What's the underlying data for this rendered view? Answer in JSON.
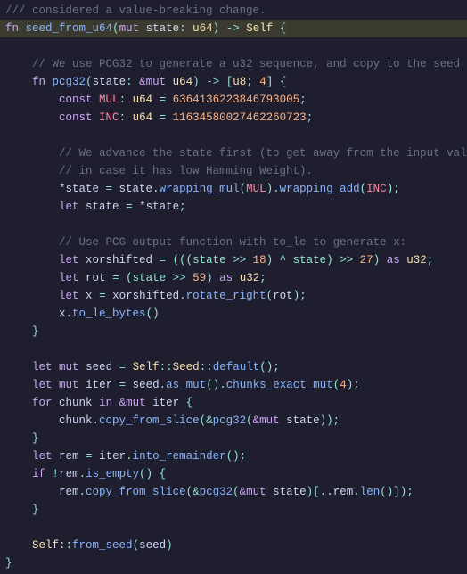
{
  "code": {
    "l0": "/// considered a value-breaking change.",
    "sig_fn": "fn",
    "sig_name": "seed_from_u64",
    "sig_mut": "mut",
    "sig_param": "state",
    "sig_ptype": "u64",
    "sig_ret": "Self",
    "c1": "// We use PCG32 to generate a u32 sequence, and copy to the seed",
    "pcg_fn": "fn",
    "pcg_name": "pcg32",
    "pcg_param": "state",
    "pcg_ref": "&mut",
    "pcg_ptype": "u64",
    "pcg_ret_arr_ty": "u8",
    "pcg_ret_arr_n": "4",
    "const1_kw": "const",
    "const1_name": "MUL",
    "const1_ty": "u64",
    "const1_val": "6364136223846793005",
    "const2_kw": "const",
    "const2_name": "INC",
    "const2_ty": "u64",
    "const2_val": "11634580027462260723",
    "c2a": "// We advance the state first (to get away from the input value,",
    "c2b": "// in case it has low Hamming Weight).",
    "adv_lhs": "*state",
    "adv_eq": " = ",
    "adv_state": "state",
    "adv_wm": "wrapping_mul",
    "adv_mul": "MUL",
    "adv_wa": "wrapping_add",
    "adv_inc": "INC",
    "let1_kw": "let",
    "let1_name": "state",
    "let1_rhs": "*state",
    "c3": "// Use PCG output function with to_le to generate x:",
    "xs_kw": "let",
    "xs_name": "xorshifted",
    "xs_expr_a": "(((state >> ",
    "xs_n18": "18",
    "xs_expr_b": ") ^ state) >> ",
    "xs_n27": "27",
    "xs_expr_c": ") ",
    "xs_as": "as",
    "xs_u32": "u32",
    "rot_kw": "let",
    "rot_name": "rot",
    "rot_expr_a": "(state >> ",
    "rot_n59": "59",
    "rot_expr_b": ") ",
    "rot_as": "as",
    "rot_u32": "u32",
    "x_kw": "let",
    "x_name": "x",
    "x_rhs_a": "xorshifted",
    "x_rr": "rotate_right",
    "x_arg": "rot",
    "xret_a": "x",
    "xret_fn": "to_le_bytes",
    "seed_kw": "let",
    "seed_mut": "mut",
    "seed_name": "seed",
    "seed_self": "Self",
    "seed_assoc": "Seed",
    "seed_def": "default",
    "iter_kw": "let",
    "iter_mut": "mut",
    "iter_name": "iter",
    "iter_a": "seed",
    "iter_asmut": "as_mut",
    "iter_chunks": "chunks_exact_mut",
    "iter_n4": "4",
    "for_kw": "for",
    "for_var": "chunk",
    "for_in": "in",
    "for_ref": "&mut",
    "for_iter": "iter",
    "copy1_a": "chunk",
    "copy1_fn": "copy_from_slice",
    "copy1_pcg": "pcg32",
    "copy1_ref": "&mut",
    "copy1_arg": "state",
    "rem_kw": "let",
    "rem_name": "rem",
    "rem_a": "iter",
    "rem_fn": "into_remainder",
    "if_kw": "if",
    "if_not": "!",
    "if_a": "rem",
    "if_fn": "is_empty",
    "copy2_a": "rem",
    "copy2_fn": "copy_from_slice",
    "copy2_pcg": "pcg32",
    "copy2_ref": "&mut",
    "copy2_arg": "state",
    "copy2_slice_a": "..rem",
    "copy2_len": "len",
    "ret_self": "Self",
    "ret_fn": "from_seed",
    "ret_arg": "seed"
  }
}
